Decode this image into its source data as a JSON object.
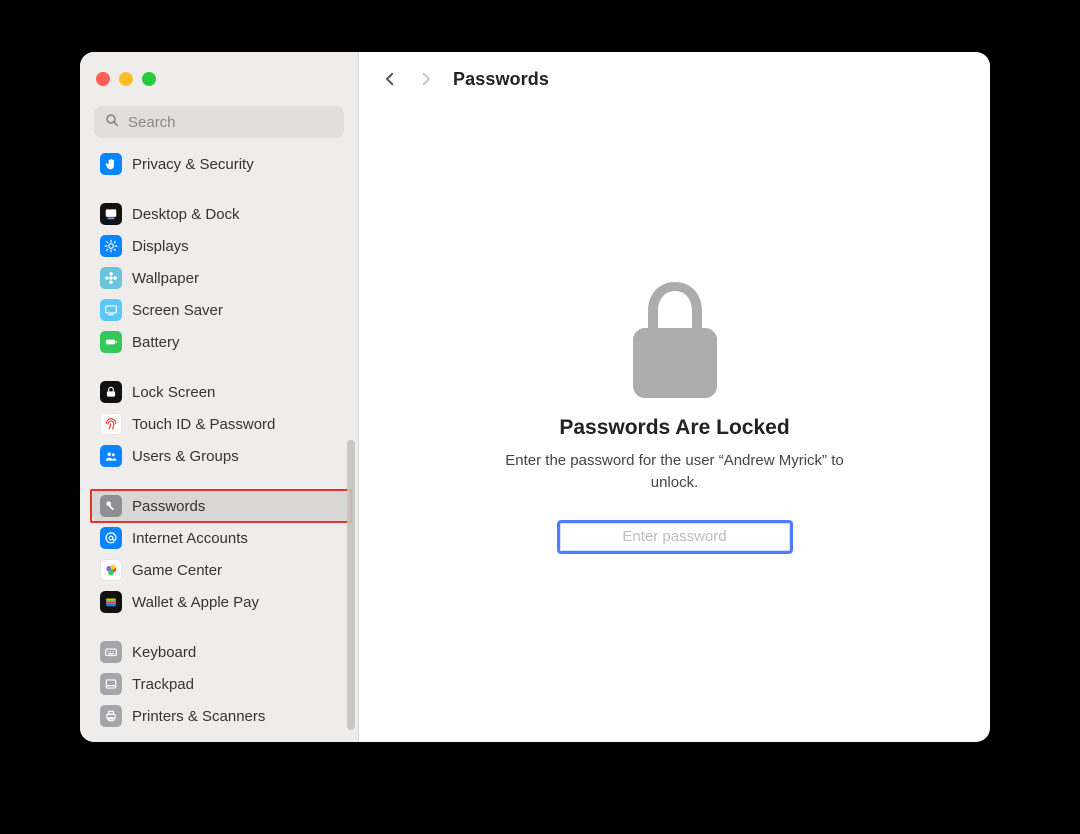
{
  "window": {
    "traffic": [
      "close",
      "minimize",
      "zoom"
    ]
  },
  "search": {
    "placeholder": "Search",
    "value": ""
  },
  "sidebar": {
    "items": [
      {
        "id": "privacy-security",
        "label": "Privacy & Security",
        "iconBg": "#0a84ff",
        "iconFg": "#ffffff",
        "glyph": "hand",
        "selected": false,
        "highlight": false,
        "spacerBefore": false
      },
      {
        "id": "desktop-dock",
        "label": "Desktop & Dock",
        "iconBg": "#111111",
        "iconFg": "#ffffff",
        "glyph": "dock",
        "selected": false,
        "highlight": false,
        "spacerBefore": true
      },
      {
        "id": "displays",
        "label": "Displays",
        "iconBg": "#0a84ff",
        "iconFg": "#ffffff",
        "glyph": "sun",
        "selected": false,
        "highlight": false,
        "spacerBefore": false
      },
      {
        "id": "wallpaper",
        "label": "Wallpaper",
        "iconBg": "#6ac4dc",
        "iconFg": "#ffffff",
        "glyph": "flower",
        "selected": false,
        "highlight": false,
        "spacerBefore": false
      },
      {
        "id": "screen-saver",
        "label": "Screen Saver",
        "iconBg": "#5ac8fa",
        "iconFg": "#ffffff",
        "glyph": "screen",
        "selected": false,
        "highlight": false,
        "spacerBefore": false
      },
      {
        "id": "battery",
        "label": "Battery",
        "iconBg": "#34c759",
        "iconFg": "#ffffff",
        "glyph": "battery",
        "selected": false,
        "highlight": false,
        "spacerBefore": false
      },
      {
        "id": "lock-screen",
        "label": "Lock Screen",
        "iconBg": "#111111",
        "iconFg": "#ffffff",
        "glyph": "lockshape",
        "selected": false,
        "highlight": false,
        "spacerBefore": true
      },
      {
        "id": "touchid-password",
        "label": "Touch ID & Password",
        "iconBg": "#ffffff",
        "iconFg": "#ff3b30",
        "glyph": "fingerprint",
        "selected": false,
        "highlight": false,
        "spacerBefore": false,
        "ring": "#e6e6e6"
      },
      {
        "id": "users-groups",
        "label": "Users & Groups",
        "iconBg": "#0a84ff",
        "iconFg": "#ffffff",
        "glyph": "people",
        "selected": false,
        "highlight": false,
        "spacerBefore": false
      },
      {
        "id": "passwords",
        "label": "Passwords",
        "iconBg": "#8e8e93",
        "iconFg": "#ffffff",
        "glyph": "key",
        "selected": true,
        "highlight": true,
        "spacerBefore": true
      },
      {
        "id": "internet-accounts",
        "label": "Internet Accounts",
        "iconBg": "#0a84ff",
        "iconFg": "#ffffff",
        "glyph": "at",
        "selected": false,
        "highlight": false,
        "spacerBefore": false
      },
      {
        "id": "game-center",
        "label": "Game Center",
        "iconBg": "#ffffff",
        "iconFg": "#ffffff",
        "glyph": "gamecenter",
        "selected": false,
        "highlight": false,
        "spacerBefore": false,
        "ring": "#e6e6e6"
      },
      {
        "id": "wallet-applepay",
        "label": "Wallet & Apple Pay",
        "iconBg": "#111111",
        "iconFg": "#ffffff",
        "glyph": "wallet",
        "selected": false,
        "highlight": false,
        "spacerBefore": false
      },
      {
        "id": "keyboard",
        "label": "Keyboard",
        "iconBg": "#a5a5aa",
        "iconFg": "#ffffff",
        "glyph": "keyboard",
        "selected": false,
        "highlight": false,
        "spacerBefore": true
      },
      {
        "id": "trackpad",
        "label": "Trackpad",
        "iconBg": "#a5a5aa",
        "iconFg": "#ffffff",
        "glyph": "trackpad",
        "selected": false,
        "highlight": false,
        "spacerBefore": false
      },
      {
        "id": "printers-scanners",
        "label": "Printers & Scanners",
        "iconBg": "#a5a5aa",
        "iconFg": "#ffffff",
        "glyph": "printer",
        "selected": false,
        "highlight": false,
        "spacerBefore": false
      }
    ]
  },
  "header": {
    "title": "Passwords",
    "back_enabled": true,
    "forward_enabled": false
  },
  "locked": {
    "title": "Passwords Are Locked",
    "subtitle": "Enter the password for the user “Andrew Myrick” to unlock.",
    "placeholder": "Enter password",
    "value": ""
  }
}
